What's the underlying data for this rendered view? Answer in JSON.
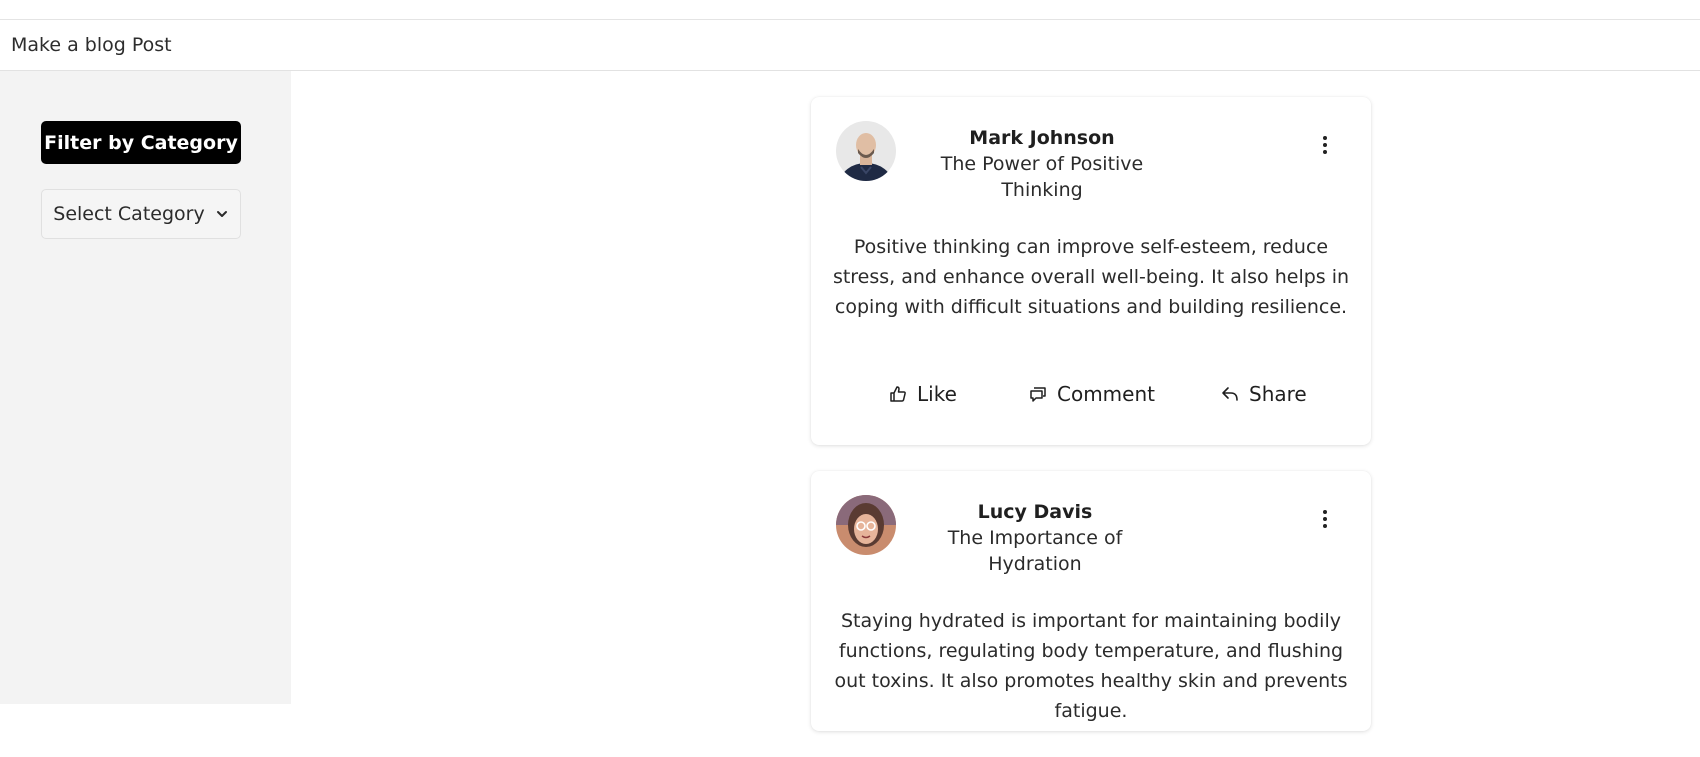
{
  "header": {
    "make_post_label": "Make a blog Post"
  },
  "sidebar": {
    "filter_label": "Filter by Category",
    "select_label": "Select Category"
  },
  "posts": [
    {
      "author": "Mark Johnson",
      "title": "The Power of Positive Thinking",
      "body": "Positive thinking can improve self-esteem, reduce stress, and enhance overall well-being. It also helps in coping with difficult situations and building resilience.",
      "actions": {
        "like": "Like",
        "comment": "Comment",
        "share": "Share"
      }
    },
    {
      "author": "Lucy Davis",
      "title": "The Importance of Hydration",
      "body": "Staying hydrated is important for maintaining bodily functions, regulating body temperature, and flushing out toxins. It also promotes healthy skin and prevents fatigue."
    }
  ],
  "colors": {
    "sidebar_bg": "#f3f3f3",
    "filter_button_bg": "#000000",
    "filter_button_text": "#ffffff"
  },
  "icons": {
    "more": "more-vertical-icon",
    "like": "thumbs-up-icon",
    "comment": "comment-icon",
    "share": "share-icon",
    "dropdown": "chevron-down-icon"
  }
}
